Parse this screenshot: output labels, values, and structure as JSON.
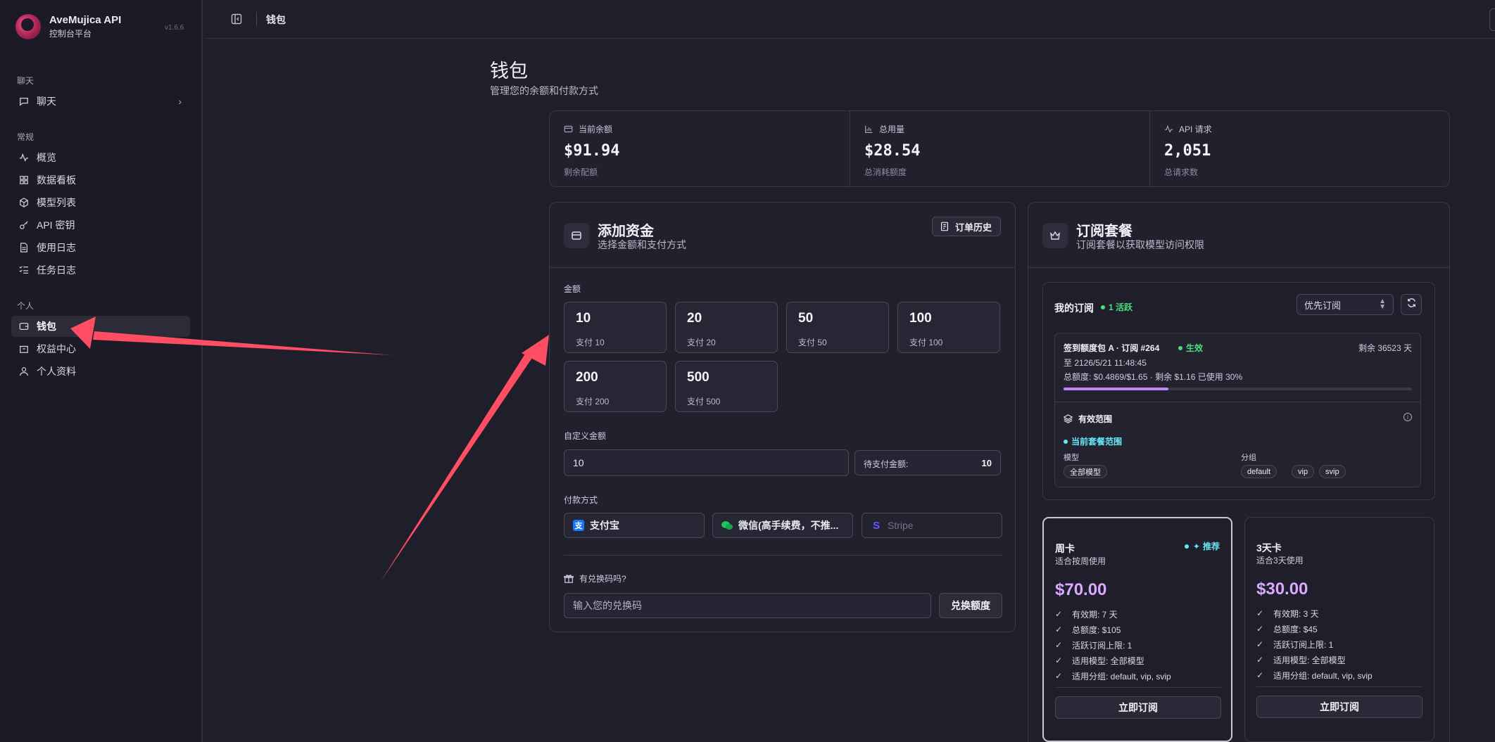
{
  "brand": {
    "title": "AveMujica API",
    "subtitle": "控制台平台",
    "version": "v1.6.6"
  },
  "sidebar": {
    "sections": [
      {
        "label": "聊天",
        "items": [
          {
            "label": "聊天",
            "icon": "chat-icon",
            "has_chevron": true
          }
        ]
      },
      {
        "label": "常规",
        "items": [
          {
            "label": "概览",
            "icon": "activity-icon"
          },
          {
            "label": "数据看板",
            "icon": "grid-icon"
          },
          {
            "label": "模型列表",
            "icon": "cube-icon"
          },
          {
            "label": "API 密钥",
            "icon": "key-icon"
          },
          {
            "label": "使用日志",
            "icon": "file-icon"
          },
          {
            "label": "任务日志",
            "icon": "task-list-icon"
          }
        ]
      },
      {
        "label": "个人",
        "items": [
          {
            "label": "钱包",
            "icon": "wallet-icon",
            "active": true
          },
          {
            "label": "权益中心",
            "icon": "box-icon"
          },
          {
            "label": "个人资料",
            "icon": "user-icon"
          }
        ]
      }
    ]
  },
  "topbar": {
    "breadcrumb": "钱包"
  },
  "page": {
    "title": "钱包",
    "subtitle": "管理您的余额和付款方式"
  },
  "stats": [
    {
      "label": "当前余额",
      "value": "$91.94",
      "foot": "剩余配额",
      "icon": "card-icon"
    },
    {
      "label": "总用量",
      "value": "$28.54",
      "foot": "总消耗额度",
      "icon": "bar-chart-icon"
    },
    {
      "label": "API 请求",
      "value": "2,051",
      "foot": "总请求数",
      "icon": "activity-icon"
    }
  ],
  "funds": {
    "title": "添加资金",
    "subtitle": "选择金额和支付方式",
    "history_button": "订单历史",
    "amount_label": "金额",
    "amounts": [
      {
        "value": "10",
        "pay": "支付 10"
      },
      {
        "value": "20",
        "pay": "支付 20"
      },
      {
        "value": "50",
        "pay": "支付 50"
      },
      {
        "value": "100",
        "pay": "支付 100"
      },
      {
        "value": "200",
        "pay": "支付 200"
      },
      {
        "value": "500",
        "pay": "支付 500"
      }
    ],
    "custom_label": "自定义金额",
    "custom_value": "10",
    "pending_label": "待支付金额:",
    "pending_value": "10",
    "payment_label": "付款方式",
    "payments": [
      {
        "label": "支付宝",
        "icon": "alipay-icon",
        "color": "#1677ff"
      },
      {
        "label": "微信(高手续费，不推...",
        "icon": "wechat-icon",
        "color": "#22c55e"
      },
      {
        "label": "Stripe",
        "icon": "stripe-icon",
        "color": "#635bff",
        "disabled": true
      }
    ],
    "redeem_label": "有兑换码吗?",
    "redeem_placeholder": "输入您的兑换码",
    "redeem_button": "兑换额度"
  },
  "subs": {
    "title": "订阅套餐",
    "subtitle": "订阅套餐以获取模型访问权限",
    "my_title": "我的订阅",
    "active_count": "1 活跃",
    "sort_select": "优先订阅",
    "item": {
      "name": "签到额度包 A · 订阅 #264",
      "status": "生效",
      "remaining": "剩余 36523 天",
      "until": "至 2126/5/21 11:48:45",
      "quota": "总额度: $0.4869/$1.65 · 剩余 $1.16  已使用 30%",
      "used_ratio": 0.3,
      "scope_title": "有效范围",
      "current_scope": "当前套餐范围",
      "model_label": "模型",
      "model_chip": "全部模型",
      "group_label": "分组",
      "groups": [
        "default",
        "vip",
        "svip"
      ]
    },
    "plans": [
      {
        "name": "周卡",
        "desc": "适合按周使用",
        "badge": "推荐",
        "price": "$70.00",
        "features": [
          "有效期: 7 天",
          "总额度: $105",
          "活跃订阅上限: 1",
          "适用模型: 全部模型",
          "适用分组: default, vip, svip"
        ],
        "button": "立即订阅"
      },
      {
        "name": "3天卡",
        "desc": "适合3天使用",
        "badge": "",
        "price": "$30.00",
        "features": [
          "有效期: 3 天",
          "总额度: $45",
          "活跃订阅上限: 1",
          "适用模型: 全部模型",
          "适用分组: default, vip, svip"
        ],
        "button": "立即订阅"
      }
    ]
  },
  "colors": {
    "background": "#1f1e2b",
    "accent": "#c084fc",
    "active_green": "#4ade80",
    "annotation_arrow": "#ff4d63"
  }
}
